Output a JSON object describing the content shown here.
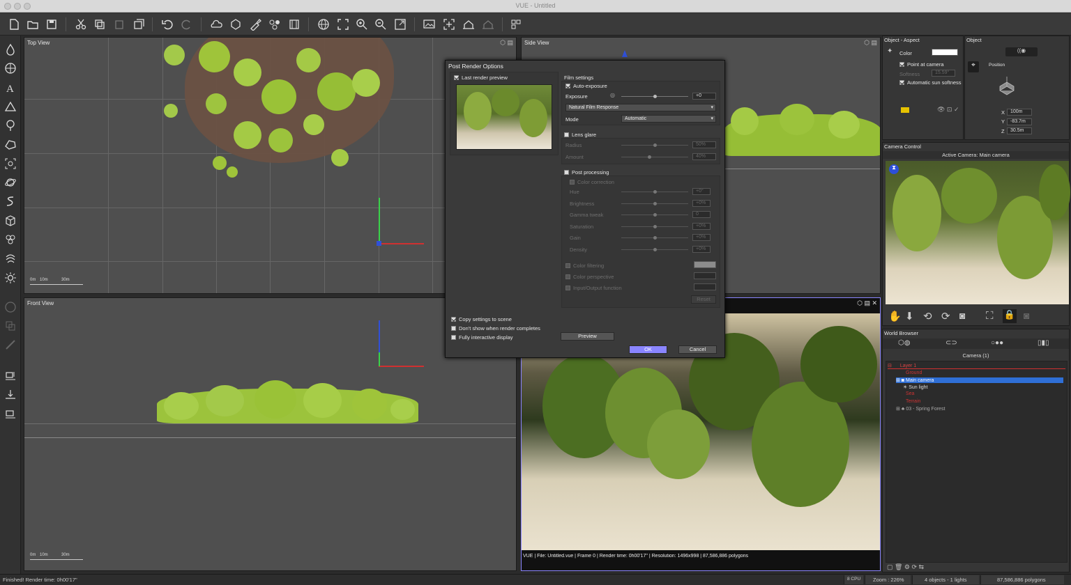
{
  "window": {
    "title": "VUE - Untitled"
  },
  "viewports": {
    "top": {
      "label": "Top View",
      "scale_ticks": [
        "0m",
        "10m",
        "30m"
      ]
    },
    "side": {
      "label": "Side View"
    },
    "front": {
      "label": "Front View",
      "scale_ticks": [
        "0m",
        "10m",
        "30m"
      ]
    },
    "render_info": "VUE | File: Untitled.vue | Frame 0 | Render time: 0h00'17\" | Resolution: 1496x998 | 87,586,886 polygons"
  },
  "dialog": {
    "title": "Post Render Options",
    "last_render_preview": "Last render preview",
    "film_settings": "Film settings",
    "auto_exposure": "Auto-exposure",
    "exposure_label": "Exposure",
    "exposure_value": "+0",
    "film_response": "Natural Film Response",
    "mode_label": "Mode",
    "mode_value": "Automatic",
    "lens_glare": "Lens glare",
    "radius_label": "Radius",
    "radius_value": "50%",
    "amount_label": "Amount",
    "amount_value": "40%",
    "post_processing": "Post processing",
    "color_correction": "Color correction",
    "pp_rows": [
      {
        "label": "Hue",
        "value": "+0°"
      },
      {
        "label": "Brightness",
        "value": "+0%"
      },
      {
        "label": "Gamma tweak",
        "value": "0"
      },
      {
        "label": "Saturation",
        "value": "+0%"
      },
      {
        "label": "Gain",
        "value": "+0%"
      },
      {
        "label": "Density",
        "value": "+0%"
      }
    ],
    "color_filtering": "Color filtering",
    "color_perspective": "Color perspective",
    "io_function": "Input/Output function",
    "reset": "Reset",
    "copy_settings": "Copy settings to scene",
    "dont_show": "Don't show when render completes",
    "fully_interactive": "Fully interactive display",
    "preview_btn": "Preview",
    "ok_btn": "OK",
    "cancel_btn": "Cancel"
  },
  "object_aspect": {
    "title": "Object - Aspect",
    "color_label": "Color",
    "point_at_camera": "Point at camera",
    "softness_label": "Softness",
    "softness_value": "15.59°",
    "auto_sun_softness": "Automatic sun softness"
  },
  "object_panel": {
    "title": "Object",
    "position_label": "Position",
    "x_label": "X",
    "x_value": "100m",
    "y_label": "Y",
    "y_value": "-83.7m",
    "z_label": "Z",
    "z_value": "30.5m"
  },
  "camera_control": {
    "title": "Camera Control",
    "active_camera": "Active Camera: Main camera"
  },
  "world_browser": {
    "title": "World Browser",
    "tab_label": "Camera (1)",
    "items": [
      {
        "label": "Layer 1"
      },
      {
        "label": "Ground"
      },
      {
        "label": "Main camera"
      },
      {
        "label": "Sun light"
      },
      {
        "label": "Sea"
      },
      {
        "label": "Terrain"
      },
      {
        "label": "03 - Spring Forest"
      }
    ]
  },
  "status": {
    "message": "Finished! Render time: 0h00'17\"",
    "cpu": "8 CPU",
    "zoom": "Zoom : 226%",
    "objects": "4 objects - 1 lights",
    "polygons": "87,586,886 polygons"
  },
  "colors": {
    "accent": "#8a85ff",
    "selection": "#2f6fd6",
    "foliage": "#9fc43a"
  }
}
